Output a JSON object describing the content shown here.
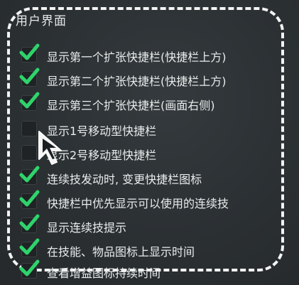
{
  "panel": {
    "title": "用户界面"
  },
  "colors": {
    "check": "#2fd36b",
    "frame": "#f4f4f4"
  },
  "options": [
    {
      "label": "显示第一个扩张快捷栏(快捷栏上方)",
      "checked": true
    },
    {
      "label": "显示第二个扩张快捷栏(快捷栏上方)",
      "checked": true
    },
    {
      "label": "显示第三个扩张快捷栏(画面右侧)",
      "checked": true
    },
    {
      "label": "显示1号移动型快捷栏",
      "checked": false
    },
    {
      "label": "显示2号移动型快捷栏",
      "checked": false
    },
    {
      "label": "连续技发动时, 变更快捷栏图标",
      "checked": true
    },
    {
      "label": "快捷栏中优先显示可以使用的连续技",
      "checked": true
    },
    {
      "label": "显示连续技提示",
      "checked": true
    },
    {
      "label": "在技能、物品图标上显示时间",
      "checked": true
    },
    {
      "label": "查看增益图标持续时间",
      "checked": true
    }
  ]
}
